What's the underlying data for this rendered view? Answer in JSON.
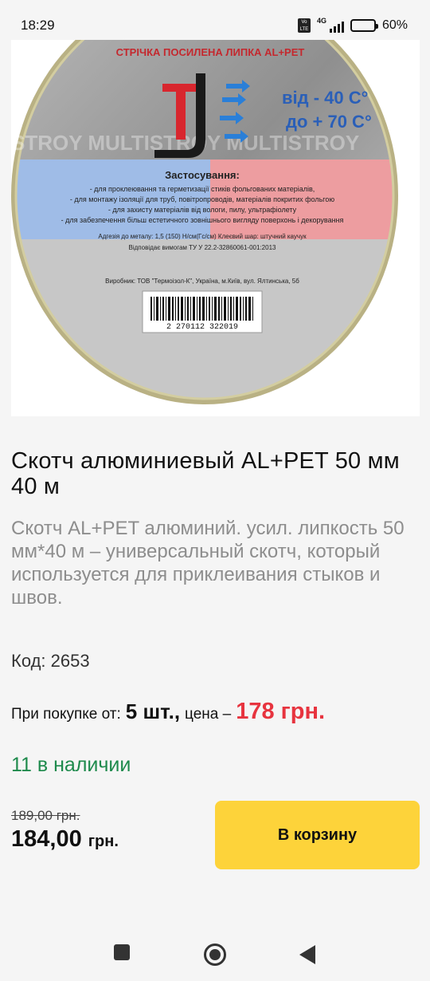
{
  "status_bar": {
    "time": "18:29",
    "volte_label": "Vo LTE",
    "network": "4G",
    "battery_percent": 60,
    "battery_text": "60%"
  },
  "product": {
    "image_label": {
      "header": "СТРІЧКА ПОСИЛЕНА ЛИПКА AL+PET",
      "logo_letter": "T",
      "temp_from": "від  - 40 C°",
      "temp_to": "до + 70 C°",
      "use_title": "Застосування:",
      "use_line1": "- для проклеювання та герметизації стиків фольгованих матеріалів,",
      "use_line2": "- для монтажу ізоляції для труб, повітропроводів, матеріалів покритих фольгою",
      "use_line3": "- для захисту матеріалів від вологи, пилу, ультрафіолету",
      "use_line4": "- для забезпечення більш естетичного зовнішнього вигляду поверхонь і декорування",
      "adhesion": "Адгезія до металу: 1,5 (150) Н/см(Гс/см)     Клеєвий шар: штучний каучук",
      "standard": "Відповідає вимогам ТУ У 22.2-32860061-001:2013",
      "maker": "Виробник: ТОВ \"Термоізол-К\", Україна, м.Київ, вул. Ялтинська, 5б",
      "barcode_number": "2 270112 322019",
      "watermark": "STROY MULTISTROY MULTISTROY"
    },
    "title": "Скотч алюминиевый AL+PET 50 мм 40 м",
    "description": "Скотч AL+PET алюминий. усил. липкость 50 мм*40 м – универсальный скотч, который используется для приклеивания стыков и швов.",
    "code_text": "Код: 2653",
    "bulk": {
      "label": "При покупке от:",
      "quantity": "5 шт.,",
      "price_label": "цена –",
      "price": "178 грн."
    },
    "stock_text": "11 в наличии",
    "old_price": "189,00 грн.",
    "price_amount": "184,00",
    "price_currency": "грн.",
    "cart_button_label": "В корзину"
  },
  "colors": {
    "accent_yellow": "#fdd33a",
    "price_red": "#e7343f",
    "stock_green": "#1e8a4c",
    "description_gray": "#8d8d8d"
  },
  "nav_bar": {
    "icons": [
      "recent-apps-icon",
      "home-icon",
      "back-icon"
    ]
  }
}
